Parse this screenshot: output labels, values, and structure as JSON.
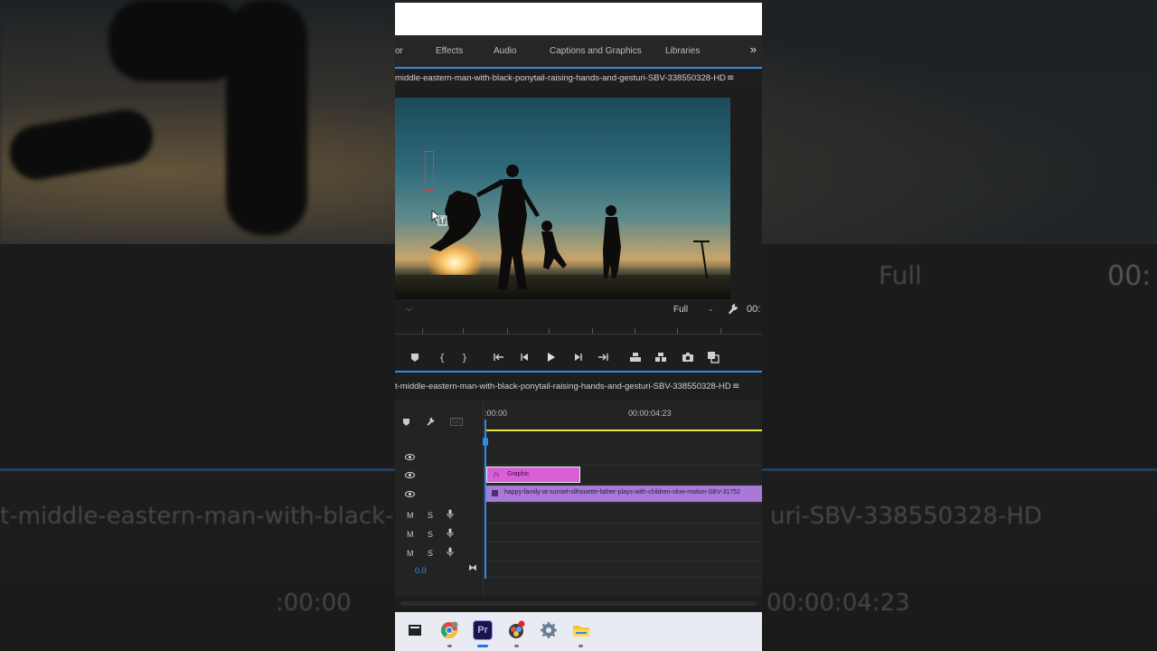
{
  "backdrop": {
    "left_text": "t-middle-eastern-man-with-black-",
    "right_text": "uri-SBV-338550328-HD",
    "full_text": "Full",
    "tc_left": ":00:00",
    "tc_right": "00:00:04:23",
    "tc_top": "00:"
  },
  "workspace": {
    "tabs": [
      {
        "label": "or"
      },
      {
        "label": "Effects"
      },
      {
        "label": "Audio"
      },
      {
        "label": "Captions and Graphics"
      },
      {
        "label": "Libraries"
      }
    ],
    "more_icon": "double-chevron-right-icon"
  },
  "program_monitor": {
    "title": "middle-eastern-man-with-black-ponytail-raising-hands-and-gesturi-SBV-338550328-HD",
    "fit": "Full",
    "timecode": "00:"
  },
  "timeline": {
    "sequence_title": "t-middle-eastern-man-with-black-ponytail-raising-hands-and-gesturi-SBV-338550328-HD",
    "timecode_start": ":00:00",
    "timecode_mark": "00:00:04:23",
    "zoom_value": "0.0",
    "graphic_clip": {
      "fx": "fx",
      "label": "Graphic"
    },
    "video_clip": {
      "label": "happy-family-at-sunset-silhouette-father-plays-with-children-slow-motion-SBV-31752"
    },
    "audio_tracks": [
      {
        "m": "M",
        "s": "S"
      },
      {
        "m": "M",
        "s": "S"
      },
      {
        "m": "M",
        "s": "S"
      }
    ]
  },
  "taskbar": {
    "apps": [
      "file-manager-icon",
      "chrome-icon",
      "premiere-pro-icon",
      "davinci-icon",
      "settings-icon",
      "folder-icon"
    ],
    "premiere_label": "Pr"
  },
  "colors": {
    "accent_blue": "#2d8ceb",
    "work_area_yellow": "#e7e73a",
    "graphic_clip": "#d95fd7",
    "video_clip": "#a77ad8"
  }
}
